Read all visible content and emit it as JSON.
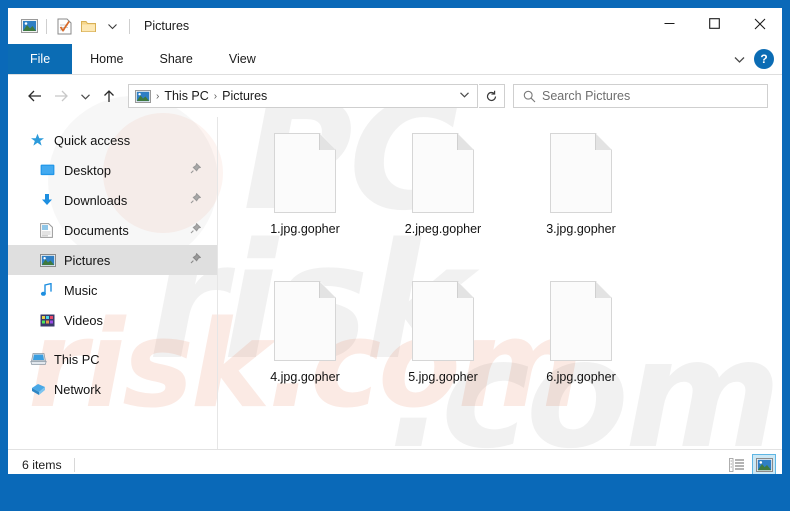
{
  "window": {
    "title": "Pictures",
    "accent_color": "#0a69b8",
    "quick_access": [
      {
        "name": "pictures-icon",
        "tooltip": "Pictures"
      },
      {
        "name": "properties-icon",
        "tooltip": "Properties"
      },
      {
        "name": "new-folder-icon",
        "tooltip": "New folder"
      },
      {
        "name": "customize-chevron-icon",
        "glyph": "▾"
      }
    ],
    "controls": {
      "minimize": "—",
      "maximize": "□",
      "close": "✕"
    }
  },
  "ribbon": {
    "tabs": [
      {
        "label": "File",
        "active": true
      },
      {
        "label": "Home",
        "active": false
      },
      {
        "label": "Share",
        "active": false
      },
      {
        "label": "View",
        "active": false
      }
    ],
    "expand_glyph": "∨",
    "help_glyph": "?"
  },
  "address": {
    "back_glyph": "←",
    "forward_glyph": "→",
    "recent_glyph": "∨",
    "up_glyph": "↑",
    "breadcrumbs": [
      "This PC",
      "Pictures"
    ],
    "separator": "›",
    "dropdown_glyph": "∨",
    "refresh_glyph": "↻"
  },
  "search": {
    "placeholder": "Search Pictures",
    "icon_glyph": "⌕"
  },
  "sidebar": {
    "items": [
      {
        "label": "Quick access",
        "icon": "star-icon",
        "pinned": false,
        "selected": false,
        "indent": false
      },
      {
        "label": "Desktop",
        "icon": "desktop-icon",
        "pinned": true,
        "selected": false,
        "indent": true
      },
      {
        "label": "Downloads",
        "icon": "downloads-icon",
        "pinned": true,
        "selected": false,
        "indent": true
      },
      {
        "label": "Documents",
        "icon": "documents-icon",
        "pinned": true,
        "selected": false,
        "indent": true
      },
      {
        "label": "Pictures",
        "icon": "pictures-icon",
        "pinned": true,
        "selected": true,
        "indent": true
      },
      {
        "label": "Music",
        "icon": "music-icon",
        "pinned": false,
        "selected": false,
        "indent": true
      },
      {
        "label": "Videos",
        "icon": "videos-icon",
        "pinned": false,
        "selected": false,
        "indent": true
      },
      {
        "label": "This PC",
        "icon": "this-pc-icon",
        "pinned": false,
        "selected": false,
        "indent": false
      },
      {
        "label": "Network",
        "icon": "network-icon",
        "pinned": false,
        "selected": false,
        "indent": false
      }
    ]
  },
  "files": [
    {
      "name": "1.jpg.gopher",
      "icon": "blank-document-icon"
    },
    {
      "name": "2.jpeg.gopher",
      "icon": "blank-document-icon"
    },
    {
      "name": "3.jpg.gopher",
      "icon": "blank-document-icon"
    },
    {
      "name": "4.jpg.gopher",
      "icon": "blank-document-icon"
    },
    {
      "name": "5.jpg.gopher",
      "icon": "blank-document-icon"
    },
    {
      "name": "6.jpg.gopher",
      "icon": "blank-document-icon"
    }
  ],
  "status": {
    "item_count": "6 items",
    "views": [
      {
        "name": "details-view",
        "active": false
      },
      {
        "name": "large-icons-view",
        "active": true
      }
    ]
  },
  "watermark": {
    "text": "risk.com"
  }
}
